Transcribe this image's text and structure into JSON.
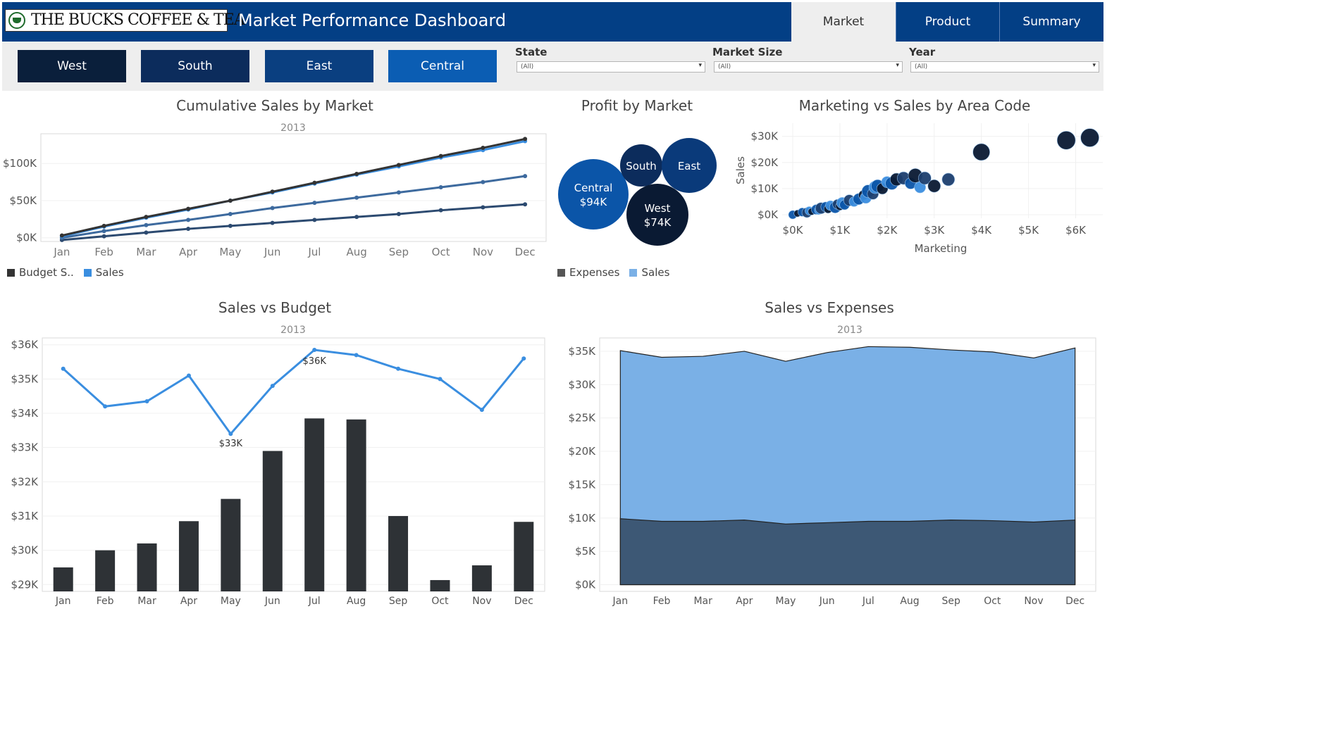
{
  "header": {
    "logo_text": "THE BUCKS COFFEE & TEA",
    "title": "Market Performance Dashboard",
    "tabs": [
      {
        "label": "Market",
        "active": true
      },
      {
        "label": "Product",
        "active": false
      },
      {
        "label": "Summary",
        "active": false
      }
    ]
  },
  "regions": [
    {
      "label": "West",
      "color": "#0a1f3b"
    },
    {
      "label": "South",
      "color": "#0c2c5c"
    },
    {
      "label": "East",
      "color": "#0a3f80"
    },
    {
      "label": "Central",
      "color": "#0b5db3"
    }
  ],
  "filters": [
    {
      "label": "State",
      "value": "(All)"
    },
    {
      "label": "Market Size",
      "value": "(All)"
    },
    {
      "label": "Year",
      "value": "(All)"
    }
  ],
  "colors": {
    "header": "#033f85",
    "dark": "#333333",
    "sales": "#3a8ee0",
    "expenses_area": "#3d5875",
    "sales_area": "#7ab0e6"
  },
  "chart_data": [
    {
      "type": "line",
      "title": "Cumulative Sales by Market",
      "subtitle": "2013",
      "categories": [
        "Jan",
        "Feb",
        "Mar",
        "Apr",
        "May",
        "Jun",
        "Jul",
        "Aug",
        "Sep",
        "Oct",
        "Nov",
        "Dec"
      ],
      "y_ticks": [
        "$0K",
        "$50K",
        "$100K"
      ],
      "ylim": [
        -5000,
        140000
      ],
      "series": [
        {
          "values": [
            3000,
            16000,
            28000,
            39000,
            50000,
            62000,
            74000,
            86000,
            98000,
            110000,
            121000,
            133000
          ],
          "color": "#333333"
        },
        {
          "values": [
            2000,
            15000,
            27000,
            38000,
            50000,
            61000,
            73000,
            85000,
            96000,
            108000,
            118000,
            130000
          ],
          "color": "#3a8ee0"
        },
        {
          "values": [
            0,
            9000,
            17000,
            24000,
            32000,
            40000,
            47000,
            54000,
            61000,
            68000,
            75000,
            83000
          ],
          "color": "#3d6a9e"
        },
        {
          "values": [
            -3000,
            2000,
            7000,
            12000,
            16000,
            20000,
            24000,
            28000,
            32000,
            37000,
            41000,
            45000
          ],
          "color": "#2c4a70"
        }
      ],
      "legend": [
        {
          "label": "Budget S..",
          "color": "#333333"
        },
        {
          "label": "Sales",
          "color": "#3a8ee0"
        }
      ]
    },
    {
      "type": "bubble",
      "title": "Profit by Market",
      "bubbles": [
        {
          "label": "Central",
          "value_label": "$94K",
          "color": "#0b55a8"
        },
        {
          "label": "South",
          "value_label": "",
          "color": "#0c2c5c"
        },
        {
          "label": "East",
          "value_label": "",
          "color": "#0a3a7a"
        },
        {
          "label": "West",
          "value_label": "$74K",
          "color": "#0a1a33"
        }
      ],
      "legend": [
        {
          "label": "Expenses",
          "color": "#555555"
        },
        {
          "label": "Sales",
          "color": "#7ab0e6"
        }
      ]
    },
    {
      "type": "scatter",
      "title": "Marketing vs Sales by Area Code",
      "xlabel": "Marketing",
      "ylabel": "Sales",
      "x_ticks": [
        "$0K",
        "$1K",
        "$2K",
        "$3K",
        "$4K",
        "$5K",
        "$6K"
      ],
      "y_ticks": [
        "$0K",
        "$10K",
        "$20K",
        "$30K"
      ],
      "xlim": [
        0,
        6500
      ],
      "ylim": [
        0,
        31000
      ],
      "points": [
        [
          0,
          0,
          "#0b55a8",
          6
        ],
        [
          100,
          500,
          "#0a1a33",
          5
        ],
        [
          200,
          1000,
          "#0b55a8",
          6
        ],
        [
          300,
          800,
          "#1d3f6e",
          7
        ],
        [
          350,
          1500,
          "#3a8ee0",
          6
        ],
        [
          400,
          1200,
          "#0a1a33",
          5
        ],
        [
          500,
          2000,
          "#0b55a8",
          7
        ],
        [
          550,
          1700,
          "#3a8ee0",
          6
        ],
        [
          600,
          2500,
          "#1d3f6e",
          8
        ],
        [
          700,
          3000,
          "#0b55a8",
          7
        ],
        [
          750,
          2200,
          "#0a1a33",
          6
        ],
        [
          800,
          3500,
          "#3a8ee0",
          7
        ],
        [
          900,
          2800,
          "#0b55a8",
          8
        ],
        [
          950,
          4000,
          "#1d3f6e",
          7
        ],
        [
          1000,
          3300,
          "#0a1a33",
          6
        ],
        [
          1050,
          4500,
          "#3a8ee0",
          8
        ],
        [
          1100,
          3800,
          "#0b55a8",
          7
        ],
        [
          1200,
          5500,
          "#1d3f6e",
          8
        ],
        [
          1300,
          5000,
          "#3a8ee0",
          7
        ],
        [
          1400,
          6000,
          "#0b55a8",
          8
        ],
        [
          1500,
          7500,
          "#0a1a33",
          7
        ],
        [
          1550,
          6500,
          "#3a8ee0",
          8
        ],
        [
          1600,
          9000,
          "#0b55a8",
          9
        ],
        [
          1700,
          8000,
          "#1d3f6e",
          8
        ],
        [
          1750,
          10500,
          "#3a8ee0",
          9
        ],
        [
          1800,
          11000,
          "#0b55a8",
          9
        ],
        [
          1900,
          10000,
          "#0a1a33",
          8
        ],
        [
          2000,
          12500,
          "#3a8ee0",
          8
        ],
        [
          2100,
          12000,
          "#0b55a8",
          9
        ],
        [
          2200,
          13500,
          "#0a1a33",
          9
        ],
        [
          2350,
          14000,
          "#1d3f6e",
          9
        ],
        [
          2500,
          12000,
          "#0b55a8",
          8
        ],
        [
          2600,
          15000,
          "#0a1a33",
          10
        ],
        [
          2700,
          10500,
          "#3a8ee0",
          8
        ],
        [
          2800,
          14000,
          "#1d3f6e",
          9
        ],
        [
          3000,
          11000,
          "#0a1a33",
          9
        ],
        [
          3300,
          13500,
          "#1d3f6e",
          9
        ],
        [
          4000,
          24000,
          "#0a1a33",
          12
        ],
        [
          5800,
          28500,
          "#0a1a33",
          13
        ],
        [
          6300,
          29500,
          "#0a1a33",
          13
        ]
      ]
    },
    {
      "type": "bar+line",
      "title": "Sales vs Budget",
      "subtitle": "2013",
      "categories": [
        "Jan",
        "Feb",
        "Mar",
        "Apr",
        "May",
        "Jun",
        "Jul",
        "Aug",
        "Sep",
        "Oct",
        "Nov",
        "Dec"
      ],
      "y_ticks": [
        "$29K",
        "$30K",
        "$31K",
        "$32K",
        "$33K",
        "$34K",
        "$35K",
        "$36K"
      ],
      "ylim": [
        28800,
        36200
      ],
      "bars": [
        29500,
        30000,
        30200,
        30850,
        31500,
        32900,
        33850,
        33820,
        31000,
        29130,
        29560,
        30830
      ],
      "line": [
        35300,
        34200,
        34350,
        35100,
        33400,
        34800,
        35850,
        35700,
        35300,
        35000,
        34100,
        35600
      ],
      "annotations": [
        {
          "index": 4,
          "label": "$33K"
        },
        {
          "index": 6,
          "label": "$36K"
        }
      ]
    },
    {
      "type": "area",
      "title": "Sales vs Expenses",
      "subtitle": "2013",
      "categories": [
        "Jan",
        "Feb",
        "Mar",
        "Apr",
        "May",
        "Jun",
        "Jul",
        "Aug",
        "Sep",
        "Oct",
        "Nov",
        "Dec"
      ],
      "y_ticks": [
        "$0K",
        "$5K",
        "$10K",
        "$15K",
        "$20K",
        "$25K",
        "$30K",
        "$35K"
      ],
      "ylim": [
        -1000,
        37000
      ],
      "sales": [
        35100,
        34100,
        34250,
        35000,
        33500,
        34800,
        35700,
        35600,
        35200,
        34900,
        34000,
        35500
      ],
      "expenses": [
        9900,
        9500,
        9500,
        9700,
        9100,
        9300,
        9500,
        9500,
        9700,
        9600,
        9400,
        9700
      ]
    }
  ]
}
